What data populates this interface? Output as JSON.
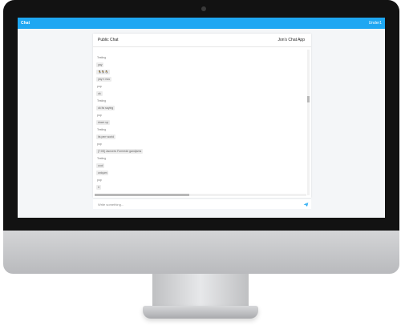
{
  "app_bar": {
    "title": "Chat",
    "user": "Under1"
  },
  "chat": {
    "title": "Public Chat",
    "app_name": "Jon's Chat App",
    "messages": [
      {
        "kind": "sender",
        "text": "Testing"
      },
      {
        "kind": "bubble",
        "text": "yay"
      },
      {
        "kind": "bubble",
        "text": "🐧🐧🐧"
      },
      {
        "kind": "bubble",
        "text": "yay n nuu"
      },
      {
        "kind": "sender",
        "text": "pop"
      },
      {
        "kind": "bubble",
        "text": "ok"
      },
      {
        "kind": "sender",
        "text": "Testing"
      },
      {
        "kind": "bubble",
        "text": "ok its saying"
      },
      {
        "kind": "sender",
        "text": "pop"
      },
      {
        "kind": "bubble",
        "text": "down up"
      },
      {
        "kind": "sender",
        "text": "Testing"
      },
      {
        "kind": "bubble",
        "text": "its perr world"
      },
      {
        "kind": "sender",
        "text": "pop"
      },
      {
        "kind": "bubble",
        "text": "[7:05] Jacrores Formedd gandjams"
      },
      {
        "kind": "sender",
        "text": "Testing"
      },
      {
        "kind": "bubble",
        "text": "cool"
      },
      {
        "kind": "bubble",
        "text": "uniqum"
      },
      {
        "kind": "sender",
        "text": "pop"
      },
      {
        "kind": "bubble",
        "text": "ir"
      }
    ]
  },
  "composer": {
    "placeholder": "Write something..."
  },
  "icons": {
    "send": "send-paper-plane-icon",
    "camera": "camera-icon"
  },
  "colors": {
    "accent": "#1ea7f2",
    "bubble": "#ececec"
  }
}
